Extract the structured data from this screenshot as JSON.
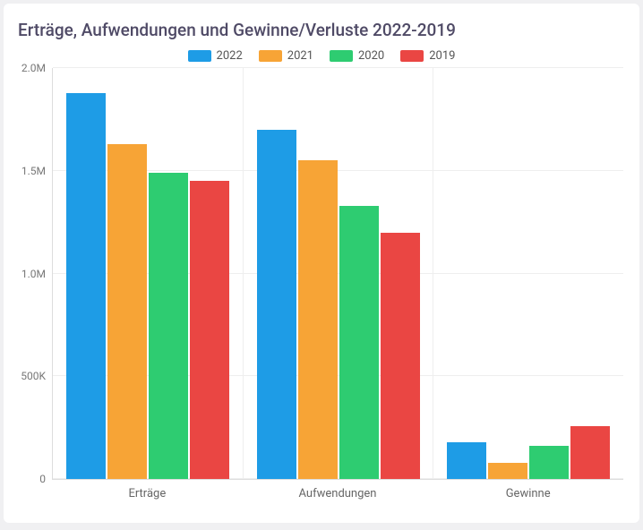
{
  "chart_data": {
    "type": "bar",
    "title": "Erträge, Aufwendungen und Gewinne/Verluste 2022-2019",
    "categories": [
      "Erträge",
      "Aufwendungen",
      "Gewinne"
    ],
    "series": [
      {
        "name": "2022",
        "color": "#1e9ce6",
        "values": [
          1880000,
          1700000,
          180000
        ]
      },
      {
        "name": "2021",
        "color": "#f7a436",
        "values": [
          1630000,
          1550000,
          80000
        ]
      },
      {
        "name": "2020",
        "color": "#2ecc71",
        "values": [
          1490000,
          1330000,
          160000
        ]
      },
      {
        "name": "2019",
        "color": "#ea4643",
        "values": [
          1450000,
          1200000,
          255000
        ]
      }
    ],
    "ylim": [
      0,
      2000000
    ],
    "y_ticks": [
      {
        "v": 0,
        "label": "0"
      },
      {
        "v": 500000,
        "label": "500K"
      },
      {
        "v": 1000000,
        "label": "1.0M"
      },
      {
        "v": 1500000,
        "label": "1.5M"
      },
      {
        "v": 2000000,
        "label": "2.0M"
      }
    ]
  }
}
